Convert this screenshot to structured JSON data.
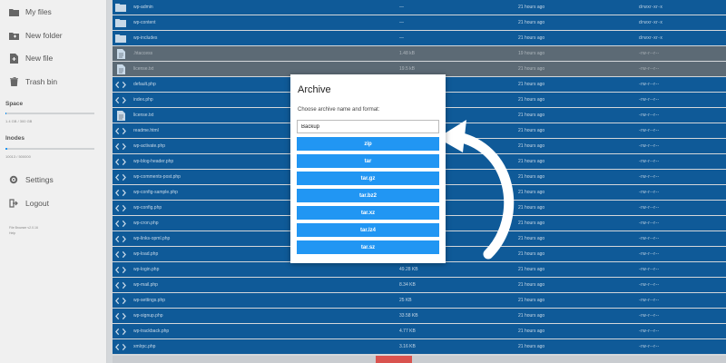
{
  "sidebar": {
    "items": [
      {
        "label": "My files",
        "icon": "folder-icon"
      },
      {
        "label": "New folder",
        "icon": "new-folder-icon"
      },
      {
        "label": "New file",
        "icon": "new-file-icon"
      },
      {
        "label": "Trash bin",
        "icon": "trash-icon"
      }
    ],
    "space": {
      "heading": "Space",
      "usage": "1.4 GB / 300 GB",
      "fraction": 0.01
    },
    "inodes": {
      "heading": "Inodes",
      "usage": "10013 / 500000",
      "fraction": 0.02
    },
    "settings": {
      "label": "Settings",
      "icon": "gear-icon"
    },
    "logout": {
      "label": "Logout",
      "icon": "logout-icon"
    },
    "footer": [
      "File Browser v2.0.16",
      "Help"
    ]
  },
  "files": [
    {
      "name": "wp-admin",
      "size": "—",
      "date": "21 hours ago",
      "perm": "drwxr-xr-x",
      "type": "folder",
      "dim": false
    },
    {
      "name": "wp-content",
      "size": "—",
      "date": "21 hours ago",
      "perm": "drwxr-xr-x",
      "type": "folder",
      "dim": false
    },
    {
      "name": "wp-includes",
      "size": "—",
      "date": "21 hours ago",
      "perm": "drwxr-xr-x",
      "type": "folder",
      "dim": false
    },
    {
      "name": ".htaccess",
      "size": "1.48 kB",
      "date": "19 hours ago",
      "perm": "-rw-r--r--",
      "type": "file",
      "dim": true
    },
    {
      "name": "license.txt",
      "size": "19.5 kB",
      "date": "21 hours ago",
      "perm": "-rw-r--r--",
      "type": "file",
      "dim": true
    },
    {
      "name": "default.php",
      "size": "",
      "date": "21 hours ago",
      "perm": "-rw-r--r--",
      "type": "code",
      "dim": false
    },
    {
      "name": "index.php",
      "size": "",
      "date": "21 hours ago",
      "perm": "-rw-r--r--",
      "type": "code",
      "dim": false
    },
    {
      "name": "license.txt",
      "size": "",
      "date": "21 hours ago",
      "perm": "-rw-r--r--",
      "type": "file",
      "dim": false
    },
    {
      "name": "readme.html",
      "size": "",
      "date": "21 hours ago",
      "perm": "-rw-r--r--",
      "type": "code",
      "dim": false
    },
    {
      "name": "wp-activate.php",
      "size": "",
      "date": "21 hours ago",
      "perm": "-rw-r--r--",
      "type": "code",
      "dim": false
    },
    {
      "name": "wp-blog-header.php",
      "size": "",
      "date": "21 hours ago",
      "perm": "-rw-r--r--",
      "type": "code",
      "dim": false
    },
    {
      "name": "wp-comments-post.php",
      "size": "",
      "date": "21 hours ago",
      "perm": "-rw-r--r--",
      "type": "code",
      "dim": false
    },
    {
      "name": "wp-config-sample.php",
      "size": "",
      "date": "21 hours ago",
      "perm": "-rw-r--r--",
      "type": "code",
      "dim": false
    },
    {
      "name": "wp-config.php",
      "size": "",
      "date": "21 hours ago",
      "perm": "-rw-r--r--",
      "type": "code",
      "dim": false
    },
    {
      "name": "wp-cron.php",
      "size": "",
      "date": "21 hours ago",
      "perm": "-rw-r--r--",
      "type": "code",
      "dim": false
    },
    {
      "name": "wp-links-opml.php",
      "size": "",
      "date": "21 hours ago",
      "perm": "-rw-r--r--",
      "type": "code",
      "dim": false
    },
    {
      "name": "wp-load.php",
      "size": "",
      "date": "21 hours ago",
      "perm": "-rw-r--r--",
      "type": "code",
      "dim": false
    },
    {
      "name": "wp-login.php",
      "size": "49.28 KB",
      "date": "21 hours ago",
      "perm": "-rw-r--r--",
      "type": "code",
      "dim": false
    },
    {
      "name": "wp-mail.php",
      "size": "8.34 KB",
      "date": "21 hours ago",
      "perm": "-rw-r--r--",
      "type": "code",
      "dim": false
    },
    {
      "name": "wp-settings.php",
      "size": "25 KB",
      "date": "21 hours ago",
      "perm": "-rw-r--r--",
      "type": "code",
      "dim": false
    },
    {
      "name": "wp-signup.php",
      "size": "33.58 KB",
      "date": "21 hours ago",
      "perm": "-rw-r--r--",
      "type": "code",
      "dim": false
    },
    {
      "name": "wp-trackback.php",
      "size": "4.77 KB",
      "date": "21 hours ago",
      "perm": "-rw-r--r--",
      "type": "code",
      "dim": false
    },
    {
      "name": "xmlrpc.php",
      "size": "3.16 KB",
      "date": "21 hours ago",
      "perm": "-rw-r--r--",
      "type": "code",
      "dim": false
    }
  ],
  "archive_modal": {
    "title": "Archive",
    "hint": "Choose archive name and format:",
    "name_value": "Backup",
    "formats": [
      "zip",
      "tar",
      "tar.gz",
      "tar.bz2",
      "tar.xz",
      "tar.lz4",
      "tar.sz"
    ]
  },
  "colors": {
    "accent": "#2196f3",
    "selection": "#0f5a98",
    "annotation_arrow": "#ffffff"
  }
}
